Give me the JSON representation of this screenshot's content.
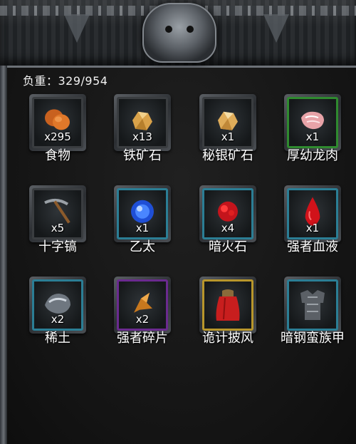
{
  "inventory": {
    "weight_label": "负重：329/954",
    "items": [
      {
        "name": "食物",
        "qty": "x295",
        "icon": "drumstick-icon",
        "rim": "#3a3d40"
      },
      {
        "name": "铁矿石",
        "qty": "x13",
        "icon": "ore-icon",
        "rim": "#3a3d40"
      },
      {
        "name": "秘银矿石",
        "qty": "x1",
        "icon": "ore-icon",
        "rim": "#3a3d40"
      },
      {
        "name": "厚幼龙肉",
        "qty": "x1",
        "icon": "meat-icon",
        "rim": "#2f8a2f"
      },
      {
        "name": "十字镐",
        "qty": "x5",
        "icon": "pickaxe-icon",
        "rim": "#3a3d40"
      },
      {
        "name": "乙太",
        "qty": "x1",
        "icon": "blue-orb-icon",
        "rim": "#2b7e95"
      },
      {
        "name": "暗火石",
        "qty": "x4",
        "icon": "red-stone-icon",
        "rim": "#2b7e95"
      },
      {
        "name": "强者血液",
        "qty": "x1",
        "icon": "blood-drop-icon",
        "rim": "#2b7e95"
      },
      {
        "name": "稀土",
        "qty": "x2",
        "icon": "rare-earth-icon",
        "rim": "#2b7e95"
      },
      {
        "name": "强者碎片",
        "qty": "x2",
        "icon": "fragment-icon",
        "rim": "#6a2a8f"
      },
      {
        "name": "诡计披风",
        "qty": "",
        "icon": "cloak-icon",
        "rim": "#b8962b"
      },
      {
        "name": "暗钢蛮族甲",
        "qty": "",
        "icon": "armor-icon",
        "rim": "#2b7e95"
      }
    ]
  }
}
